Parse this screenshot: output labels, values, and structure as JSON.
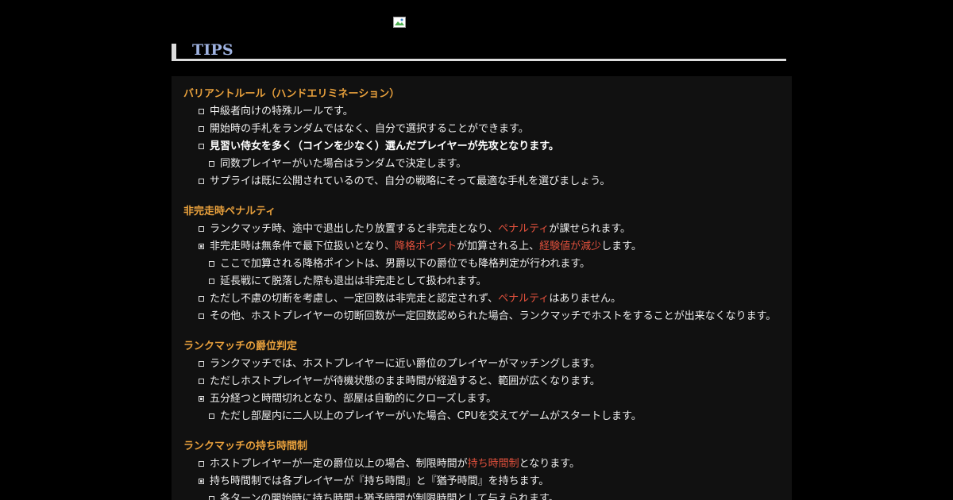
{
  "heading": {
    "title": "TIPS"
  },
  "sections": [
    {
      "title": "バリアントルール（ハンドエリミネーション）",
      "items": [
        {
          "level": 1,
          "parts": [
            {
              "text": "中級者向けの特殊ルールです。"
            }
          ]
        },
        {
          "level": 1,
          "parts": [
            {
              "text": "開始時の手札をランダムではなく、自分で選択することができます。"
            }
          ]
        },
        {
          "level": 1,
          "bold": true,
          "parts": [
            {
              "text": "見習い侍女を多く（コインを少なく）選んだプレイヤーが先攻となります。"
            }
          ]
        },
        {
          "level": 2,
          "parts": [
            {
              "text": "同数プレイヤーがいた場合はランダムで決定します。"
            }
          ]
        },
        {
          "level": 1,
          "parts": [
            {
              "text": "サプライは既に公開されているので、自分の戦略にそって最適な手札を選びましょう。"
            }
          ]
        }
      ]
    },
    {
      "title": "非完走時ペナルティ",
      "items": [
        {
          "level": 1,
          "parts": [
            {
              "text": "ランクマッチ時、途中で退出したり放置すると非完走となり、"
            },
            {
              "text": "ペナルティ",
              "highlight": true
            },
            {
              "text": "が課せられます。"
            }
          ]
        },
        {
          "level": 1,
          "filled": true,
          "parts": [
            {
              "text": "非完走時は無条件で最下位扱いとなり、"
            },
            {
              "text": "降格ポイント",
              "highlight": true
            },
            {
              "text": "が加算される上、"
            },
            {
              "text": "経験値が減少",
              "highlight": true
            },
            {
              "text": "します。"
            }
          ]
        },
        {
          "level": 2,
          "parts": [
            {
              "text": "ここで加算される降格ポイントは、男爵以下の爵位でも降格判定が行われます。"
            }
          ]
        },
        {
          "level": 2,
          "parts": [
            {
              "text": "延長戦にて脱落した際も退出は非完走として扱われます。"
            }
          ]
        },
        {
          "level": 1,
          "parts": [
            {
              "text": "ただし不慮の切断を考慮し、一定回数は非完走と認定されず、"
            },
            {
              "text": "ペナルティ",
              "highlight": true
            },
            {
              "text": "はありません。"
            }
          ]
        },
        {
          "level": 1,
          "parts": [
            {
              "text": "その他、ホストプレイヤーの切断回数が一定回数認められた場合、ランクマッチでホストをすることが出来なくなります。"
            }
          ]
        }
      ]
    },
    {
      "title": "ランクマッチの爵位判定",
      "items": [
        {
          "level": 1,
          "parts": [
            {
              "text": "ランクマッチでは、ホストプレイヤーに近い爵位のプレイヤーがマッチングします。"
            }
          ]
        },
        {
          "level": 1,
          "parts": [
            {
              "text": "ただしホストプレイヤーが待機状態のまま時間が経過すると、範囲が広くなります。"
            }
          ]
        },
        {
          "level": 1,
          "filled": true,
          "parts": [
            {
              "text": "五分経つと時間切れとなり、部屋は自動的にクローズします。"
            }
          ]
        },
        {
          "level": 2,
          "parts": [
            {
              "text": "ただし部屋内に二人以上のプレイヤーがいた場合、CPUを交えてゲームがスタートします。"
            }
          ]
        }
      ]
    },
    {
      "title": "ランクマッチの持ち時間制",
      "items": [
        {
          "level": 1,
          "parts": [
            {
              "text": "ホストプレイヤーが一定の爵位以上の場合、制限時間が"
            },
            {
              "text": "持ち時間制",
              "highlight": true
            },
            {
              "text": "となります。"
            }
          ]
        },
        {
          "level": 1,
          "filled": true,
          "parts": [
            {
              "text": "持ち時間制では各プレイヤーが『持ち時間』と『猶予時間』を持ちます。"
            }
          ]
        },
        {
          "level": 2,
          "parts": [
            {
              "text": "各ターンの開始時に持ち時間＋猶予時間が制限時間として与えられます。"
            }
          ]
        }
      ]
    }
  ],
  "colors": {
    "heading": "#9fb3e2",
    "section_title": "#e8a03c",
    "highlight": "#e0503c",
    "panel": "#111111"
  }
}
